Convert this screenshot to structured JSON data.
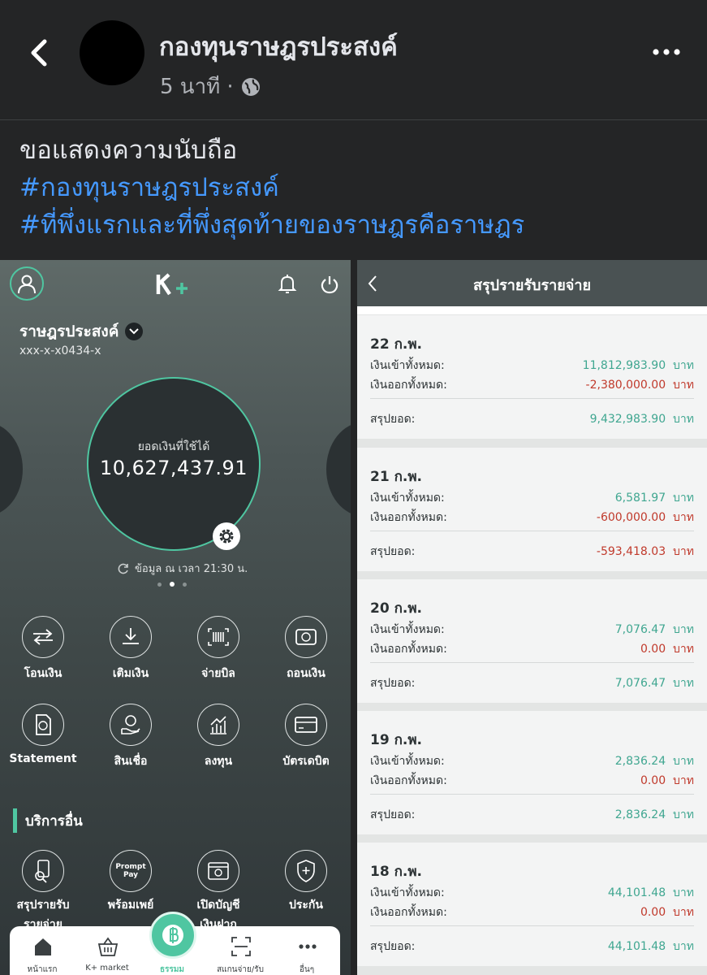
{
  "post": {
    "page_name": "กองทุนราษฎรประสงค์",
    "time": "5 นาที",
    "line1": "ขอแสดงความนับถือ",
    "tag1": "#กองทุนราษฎรประสงค์",
    "tag2": "#ที่พึ่งแรกและที่พึ่งสุดท้ายของราษฎรคือราษฎร"
  },
  "kplus": {
    "logo": "K+",
    "account_name": "ราษฎรประสงค์",
    "account_number": "xxx-x-x0434-x",
    "balance_label": "ยอดเงินที่ใช้ได้",
    "balance": "10,627,437.91",
    "data_time": "ข้อมูล ณ เวลา 21:30 น.",
    "menu": [
      {
        "label": "โอนเงิน",
        "icon": "transfer-icon"
      },
      {
        "label": "เติมเงิน",
        "icon": "topup-icon"
      },
      {
        "label": "จ่ายบิล",
        "icon": "barcode-icon"
      },
      {
        "label": "ถอนเงิน",
        "icon": "withdraw-icon"
      },
      {
        "label": "Statement",
        "icon": "statement-icon"
      },
      {
        "label": "สินเชื่อ",
        "icon": "loan-icon"
      },
      {
        "label": "ลงทุน",
        "icon": "invest-icon"
      },
      {
        "label": "บัตรเดบิต",
        "icon": "card-icon"
      }
    ],
    "other_title": "บริการอื่น",
    "other": [
      {
        "label1": "สรุปรายรับ",
        "label2": "รายจ่าย",
        "icon": "summary-icon"
      },
      {
        "label1": "พร้อมเพย์",
        "label2": "",
        "icon": "promptpay-icon",
        "icon_text": "Prompt Pay"
      },
      {
        "label1": "เปิดบัญชี",
        "label2": "เงินฝาก",
        "icon": "open-account-icon"
      },
      {
        "label1": "ประกัน",
        "label2": "",
        "icon": "insurance-icon"
      }
    ],
    "nav": [
      {
        "label": "หน้าแรก",
        "icon": "home-icon"
      },
      {
        "label": "K+ market",
        "icon": "basket-icon"
      },
      {
        "label": "ธรรมม",
        "icon": "baht-icon"
      },
      {
        "label": "สแกนจ่าย/รับ",
        "icon": "scan-icon"
      },
      {
        "label": "อื่นๆ",
        "icon": "more-icon"
      }
    ]
  },
  "summary": {
    "title": "สรุปรายรับรายจ่าย",
    "in_label": "เงินเข้าทั้งหมด:",
    "out_label": "เงินออกทั้งหมด:",
    "total_label": "สรุปยอด:",
    "unit": "บาท",
    "days": [
      {
        "date": "22 ก.พ.",
        "in": "11,812,983.90",
        "out": "-2,380,000.00",
        "total": "9,432,983.90",
        "total_sign": "pos"
      },
      {
        "date": "21 ก.พ.",
        "in": "6,581.97",
        "out": "-600,000.00",
        "total": "-593,418.03",
        "total_sign": "neg"
      },
      {
        "date": "20 ก.พ.",
        "in": "7,076.47",
        "out": "0.00",
        "total": "7,076.47",
        "total_sign": "pos"
      },
      {
        "date": "19 ก.พ.",
        "in": "2,836.24",
        "out": "0.00",
        "total": "2,836.24",
        "total_sign": "pos"
      },
      {
        "date": "18 ก.พ.",
        "in": "44,101.48",
        "out": "0.00",
        "total": "44,101.48",
        "total_sign": "pos"
      }
    ]
  },
  "colors": {
    "accent": "#4fc6a1",
    "positive": "#3fa690",
    "negative": "#c0392b",
    "link": "#4599ff"
  }
}
